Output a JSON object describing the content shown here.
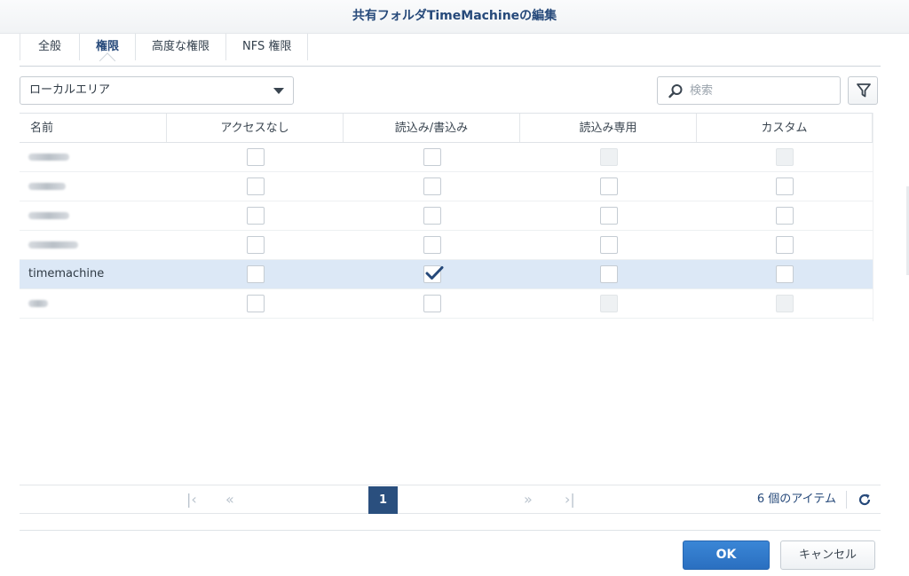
{
  "window": {
    "title": "共有フォルダTimeMachineの編集"
  },
  "tabs": [
    {
      "label": "全般",
      "active": false
    },
    {
      "label": "権限",
      "active": true
    },
    {
      "label": "高度な権限",
      "active": false
    },
    {
      "label": "NFS 権限",
      "active": false
    }
  ],
  "filter": {
    "selected": "ローカルエリア"
  },
  "search": {
    "placeholder": "検索",
    "icon": "search-icon"
  },
  "filter_button": {
    "icon": "funnel-icon"
  },
  "table": {
    "columns": [
      "名前",
      "アクセスなし",
      "読込み/書込み",
      "読込み専用",
      "カスタム"
    ],
    "rows": [
      {
        "name": "",
        "states": [
          "empty",
          "empty",
          "disabled",
          "disabled"
        ],
        "selected": false
      },
      {
        "name": "",
        "states": [
          "empty",
          "empty",
          "empty",
          "empty"
        ],
        "selected": false
      },
      {
        "name": "",
        "states": [
          "empty",
          "empty",
          "empty",
          "empty"
        ],
        "selected": false
      },
      {
        "name": "",
        "states": [
          "empty",
          "empty",
          "empty",
          "empty"
        ],
        "selected": false
      },
      {
        "name": "timemachine",
        "states": [
          "empty",
          "checked",
          "empty",
          "empty"
        ],
        "selected": true
      },
      {
        "name": "",
        "states": [
          "empty",
          "empty",
          "disabled",
          "disabled"
        ],
        "selected": false
      }
    ]
  },
  "pager": {
    "current_page": "1",
    "item_count": "6 個のアイテム"
  },
  "buttons": {
    "ok": "OK",
    "cancel": "キャンセル"
  },
  "colors": {
    "accent": "#2a6fc0",
    "title": "#26497a",
    "selected_row": "#dce8f6"
  }
}
